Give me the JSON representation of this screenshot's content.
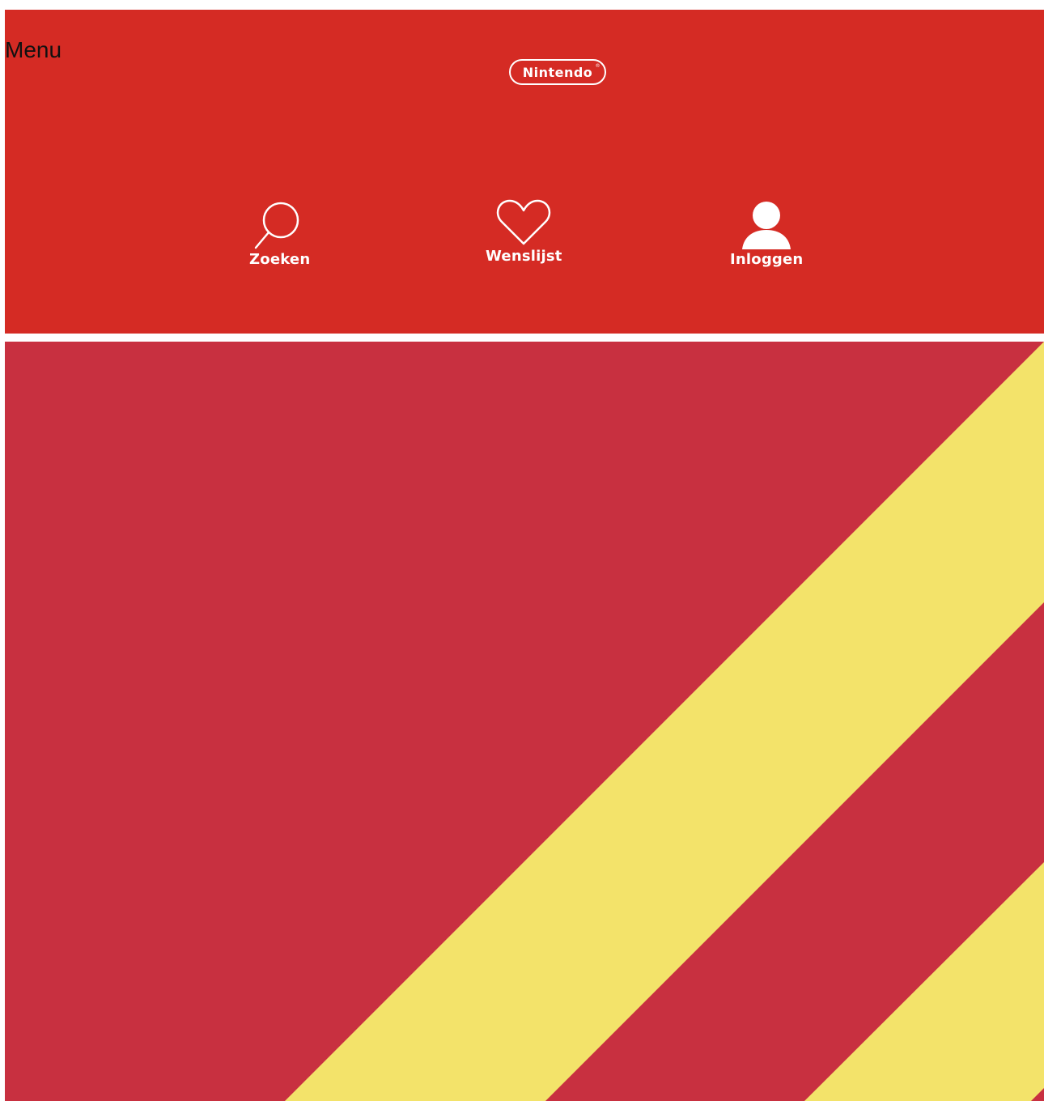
{
  "header": {
    "menu_label": "Menu",
    "logo_text": "Nintendo",
    "logo_registered": "®",
    "background_color": "#d52b24",
    "actions": [
      {
        "label": "Zoeken",
        "icon": "search-icon"
      },
      {
        "label": "Wenslijst",
        "icon": "heart-icon"
      },
      {
        "label": "Inloggen",
        "icon": "user-icon"
      }
    ]
  },
  "hero": {
    "pattern": "diagonal-stripes",
    "colors": {
      "background": "#c83040",
      "stripe": "#f3e36a"
    }
  }
}
